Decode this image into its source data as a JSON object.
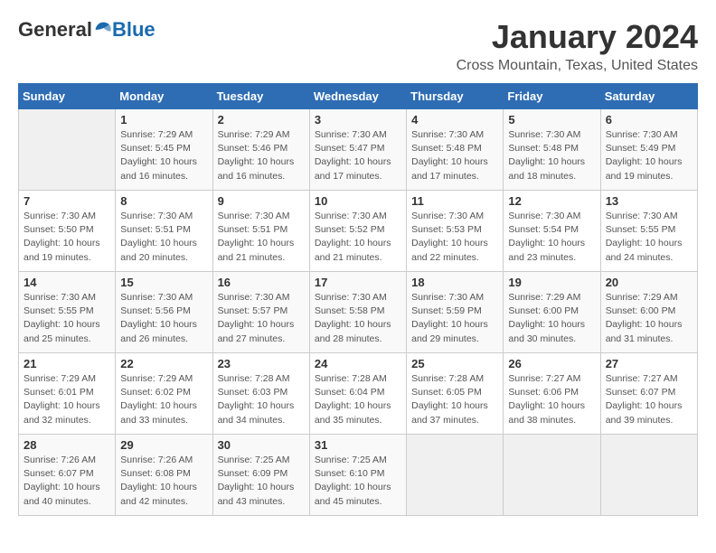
{
  "header": {
    "logo_general": "General",
    "logo_blue": "Blue",
    "month_title": "January 2024",
    "location": "Cross Mountain, Texas, United States"
  },
  "days_of_week": [
    "Sunday",
    "Monday",
    "Tuesday",
    "Wednesday",
    "Thursday",
    "Friday",
    "Saturday"
  ],
  "weeks": [
    [
      {
        "num": "",
        "sunrise": "",
        "sunset": "",
        "daylight": "",
        "empty": true
      },
      {
        "num": "1",
        "sunrise": "Sunrise: 7:29 AM",
        "sunset": "Sunset: 5:45 PM",
        "daylight": "Daylight: 10 hours and 16 minutes."
      },
      {
        "num": "2",
        "sunrise": "Sunrise: 7:29 AM",
        "sunset": "Sunset: 5:46 PM",
        "daylight": "Daylight: 10 hours and 16 minutes."
      },
      {
        "num": "3",
        "sunrise": "Sunrise: 7:30 AM",
        "sunset": "Sunset: 5:47 PM",
        "daylight": "Daylight: 10 hours and 17 minutes."
      },
      {
        "num": "4",
        "sunrise": "Sunrise: 7:30 AM",
        "sunset": "Sunset: 5:48 PM",
        "daylight": "Daylight: 10 hours and 17 minutes."
      },
      {
        "num": "5",
        "sunrise": "Sunrise: 7:30 AM",
        "sunset": "Sunset: 5:48 PM",
        "daylight": "Daylight: 10 hours and 18 minutes."
      },
      {
        "num": "6",
        "sunrise": "Sunrise: 7:30 AM",
        "sunset": "Sunset: 5:49 PM",
        "daylight": "Daylight: 10 hours and 19 minutes."
      }
    ],
    [
      {
        "num": "7",
        "sunrise": "Sunrise: 7:30 AM",
        "sunset": "Sunset: 5:50 PM",
        "daylight": "Daylight: 10 hours and 19 minutes."
      },
      {
        "num": "8",
        "sunrise": "Sunrise: 7:30 AM",
        "sunset": "Sunset: 5:51 PM",
        "daylight": "Daylight: 10 hours and 20 minutes."
      },
      {
        "num": "9",
        "sunrise": "Sunrise: 7:30 AM",
        "sunset": "Sunset: 5:51 PM",
        "daylight": "Daylight: 10 hours and 21 minutes."
      },
      {
        "num": "10",
        "sunrise": "Sunrise: 7:30 AM",
        "sunset": "Sunset: 5:52 PM",
        "daylight": "Daylight: 10 hours and 21 minutes."
      },
      {
        "num": "11",
        "sunrise": "Sunrise: 7:30 AM",
        "sunset": "Sunset: 5:53 PM",
        "daylight": "Daylight: 10 hours and 22 minutes."
      },
      {
        "num": "12",
        "sunrise": "Sunrise: 7:30 AM",
        "sunset": "Sunset: 5:54 PM",
        "daylight": "Daylight: 10 hours and 23 minutes."
      },
      {
        "num": "13",
        "sunrise": "Sunrise: 7:30 AM",
        "sunset": "Sunset: 5:55 PM",
        "daylight": "Daylight: 10 hours and 24 minutes."
      }
    ],
    [
      {
        "num": "14",
        "sunrise": "Sunrise: 7:30 AM",
        "sunset": "Sunset: 5:55 PM",
        "daylight": "Daylight: 10 hours and 25 minutes."
      },
      {
        "num": "15",
        "sunrise": "Sunrise: 7:30 AM",
        "sunset": "Sunset: 5:56 PM",
        "daylight": "Daylight: 10 hours and 26 minutes."
      },
      {
        "num": "16",
        "sunrise": "Sunrise: 7:30 AM",
        "sunset": "Sunset: 5:57 PM",
        "daylight": "Daylight: 10 hours and 27 minutes."
      },
      {
        "num": "17",
        "sunrise": "Sunrise: 7:30 AM",
        "sunset": "Sunset: 5:58 PM",
        "daylight": "Daylight: 10 hours and 28 minutes."
      },
      {
        "num": "18",
        "sunrise": "Sunrise: 7:30 AM",
        "sunset": "Sunset: 5:59 PM",
        "daylight": "Daylight: 10 hours and 29 minutes."
      },
      {
        "num": "19",
        "sunrise": "Sunrise: 7:29 AM",
        "sunset": "Sunset: 6:00 PM",
        "daylight": "Daylight: 10 hours and 30 minutes."
      },
      {
        "num": "20",
        "sunrise": "Sunrise: 7:29 AM",
        "sunset": "Sunset: 6:00 PM",
        "daylight": "Daylight: 10 hours and 31 minutes."
      }
    ],
    [
      {
        "num": "21",
        "sunrise": "Sunrise: 7:29 AM",
        "sunset": "Sunset: 6:01 PM",
        "daylight": "Daylight: 10 hours and 32 minutes."
      },
      {
        "num": "22",
        "sunrise": "Sunrise: 7:29 AM",
        "sunset": "Sunset: 6:02 PM",
        "daylight": "Daylight: 10 hours and 33 minutes."
      },
      {
        "num": "23",
        "sunrise": "Sunrise: 7:28 AM",
        "sunset": "Sunset: 6:03 PM",
        "daylight": "Daylight: 10 hours and 34 minutes."
      },
      {
        "num": "24",
        "sunrise": "Sunrise: 7:28 AM",
        "sunset": "Sunset: 6:04 PM",
        "daylight": "Daylight: 10 hours and 35 minutes."
      },
      {
        "num": "25",
        "sunrise": "Sunrise: 7:28 AM",
        "sunset": "Sunset: 6:05 PM",
        "daylight": "Daylight: 10 hours and 37 minutes."
      },
      {
        "num": "26",
        "sunrise": "Sunrise: 7:27 AM",
        "sunset": "Sunset: 6:06 PM",
        "daylight": "Daylight: 10 hours and 38 minutes."
      },
      {
        "num": "27",
        "sunrise": "Sunrise: 7:27 AM",
        "sunset": "Sunset: 6:07 PM",
        "daylight": "Daylight: 10 hours and 39 minutes."
      }
    ],
    [
      {
        "num": "28",
        "sunrise": "Sunrise: 7:26 AM",
        "sunset": "Sunset: 6:07 PM",
        "daylight": "Daylight: 10 hours and 40 minutes."
      },
      {
        "num": "29",
        "sunrise": "Sunrise: 7:26 AM",
        "sunset": "Sunset: 6:08 PM",
        "daylight": "Daylight: 10 hours and 42 minutes."
      },
      {
        "num": "30",
        "sunrise": "Sunrise: 7:25 AM",
        "sunset": "Sunset: 6:09 PM",
        "daylight": "Daylight: 10 hours and 43 minutes."
      },
      {
        "num": "31",
        "sunrise": "Sunrise: 7:25 AM",
        "sunset": "Sunset: 6:10 PM",
        "daylight": "Daylight: 10 hours and 45 minutes."
      },
      {
        "num": "",
        "sunrise": "",
        "sunset": "",
        "daylight": "",
        "empty": true
      },
      {
        "num": "",
        "sunrise": "",
        "sunset": "",
        "daylight": "",
        "empty": true
      },
      {
        "num": "",
        "sunrise": "",
        "sunset": "",
        "daylight": "",
        "empty": true
      }
    ]
  ]
}
